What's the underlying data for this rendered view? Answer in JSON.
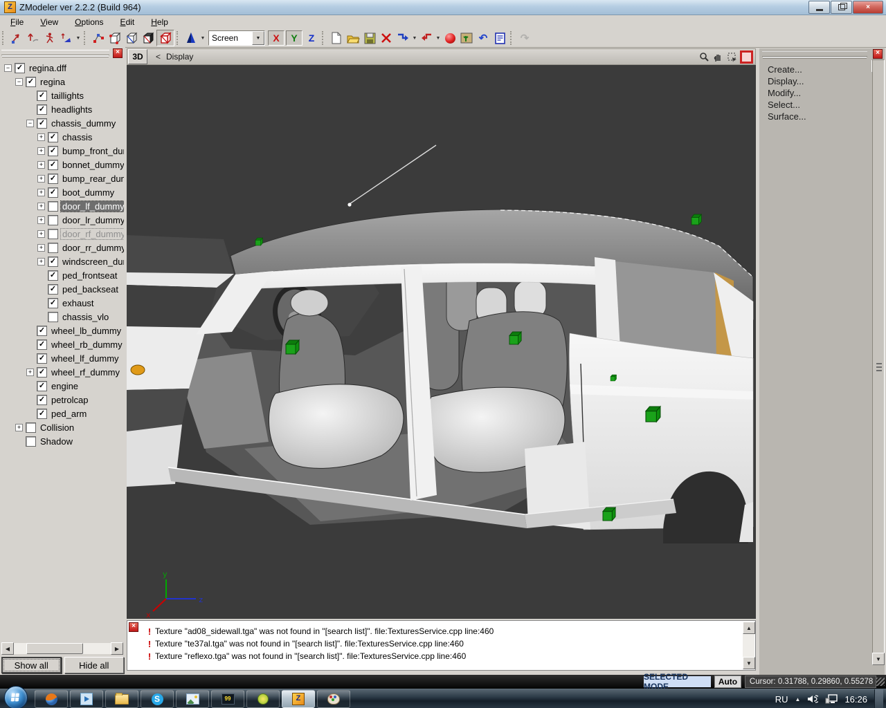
{
  "window": {
    "title": "ZModeler ver 2.2.2 (Build 964)",
    "controls": {
      "minimize": "minimize",
      "restore": "restore",
      "close": "×"
    }
  },
  "menu": {
    "items": [
      "File",
      "View",
      "Options",
      "Edit",
      "Help"
    ]
  },
  "toolbar": {
    "screen_combo": "Screen",
    "axis_x": "X",
    "axis_y": "Y",
    "axis_z": "Z",
    "undo_glyph": "↶",
    "redo_glyph": "↷",
    "icons": [
      "manipulator-move",
      "manipulator-rotate",
      "animate-figure",
      "bone-tool",
      "vertices-level",
      "edges-level",
      "polygons-level",
      "mesh-browser",
      "objects-level",
      "cone-primitive",
      "new-file",
      "open-file",
      "save-file",
      "delete",
      "import",
      "export",
      "material-editor",
      "texture-browser",
      "undo",
      "log-view",
      "redo"
    ]
  },
  "viewport": {
    "mode_button": "3D",
    "back": "<",
    "title": "Display",
    "background": "#3b3b3b"
  },
  "scene_tree": {
    "items": [
      {
        "label": "regina.dff",
        "level": 0,
        "checked": true,
        "expander": "minus",
        "state": "normal"
      },
      {
        "label": "regina",
        "level": 1,
        "checked": true,
        "expander": "minus",
        "state": "normal"
      },
      {
        "label": "taillights",
        "level": 2,
        "checked": true,
        "expander": "none",
        "state": "normal"
      },
      {
        "label": "headlights",
        "level": 2,
        "checked": true,
        "expander": "none",
        "state": "normal"
      },
      {
        "label": "chassis_dummy",
        "level": 2,
        "checked": true,
        "expander": "minus",
        "state": "normal"
      },
      {
        "label": "chassis",
        "level": 3,
        "checked": true,
        "expander": "plus",
        "state": "normal"
      },
      {
        "label": "bump_front_dur",
        "level": 3,
        "checked": true,
        "expander": "plus",
        "state": "normal"
      },
      {
        "label": "bonnet_dummy",
        "level": 3,
        "checked": true,
        "expander": "plus",
        "state": "normal"
      },
      {
        "label": "bump_rear_dum",
        "level": 3,
        "checked": true,
        "expander": "plus",
        "state": "normal"
      },
      {
        "label": "boot_dummy",
        "level": 3,
        "checked": true,
        "expander": "plus",
        "state": "normal"
      },
      {
        "label": "door_lf_dummy",
        "level": 3,
        "checked": false,
        "expander": "plus",
        "state": "selected"
      },
      {
        "label": "door_lr_dummy",
        "level": 3,
        "checked": false,
        "expander": "plus",
        "state": "normal"
      },
      {
        "label": "door_rf_dummy",
        "level": 3,
        "checked": false,
        "expander": "plus",
        "state": "dim"
      },
      {
        "label": "door_rr_dummy",
        "level": 3,
        "checked": false,
        "expander": "plus",
        "state": "normal"
      },
      {
        "label": "windscreen_dum",
        "level": 3,
        "checked": true,
        "expander": "plus",
        "state": "normal"
      },
      {
        "label": "ped_frontseat",
        "level": 3,
        "checked": true,
        "expander": "none",
        "state": "normal"
      },
      {
        "label": "ped_backseat",
        "level": 3,
        "checked": true,
        "expander": "none",
        "state": "normal"
      },
      {
        "label": "exhaust",
        "level": 3,
        "checked": true,
        "expander": "none",
        "state": "normal"
      },
      {
        "label": "chassis_vlo",
        "level": 3,
        "checked": false,
        "expander": "none",
        "state": "normal"
      },
      {
        "label": "wheel_lb_dummy",
        "level": 2,
        "checked": true,
        "expander": "none",
        "state": "normal"
      },
      {
        "label": "wheel_rb_dummy",
        "level": 2,
        "checked": true,
        "expander": "none",
        "state": "normal"
      },
      {
        "label": "wheel_lf_dummy",
        "level": 2,
        "checked": true,
        "expander": "none",
        "state": "normal"
      },
      {
        "label": "wheel_rf_dummy",
        "level": 2,
        "checked": true,
        "expander": "plus",
        "state": "normal"
      },
      {
        "label": "engine",
        "level": 2,
        "checked": true,
        "expander": "none",
        "state": "normal"
      },
      {
        "label": "petrolcap",
        "level": 2,
        "checked": true,
        "expander": "none",
        "state": "normal"
      },
      {
        "label": "ped_arm",
        "level": 2,
        "checked": true,
        "expander": "none",
        "state": "normal"
      },
      {
        "label": "Collision",
        "level": 1,
        "checked": false,
        "expander": "plus",
        "state": "normal"
      },
      {
        "label": "Shadow",
        "level": 1,
        "checked": false,
        "expander": "none",
        "state": "normal"
      }
    ]
  },
  "left_buttons": {
    "show_all": "Show all",
    "hide_all": "Hide all"
  },
  "right_menu": {
    "items": [
      "Create...",
      "Display...",
      "Modify...",
      "Select...",
      "Surface..."
    ]
  },
  "log": {
    "messages": [
      "Texture \"ad08_sidewall.tga\" was not found in \"[search list]\". file:TexturesService.cpp line:460",
      "Texture \"te37al.tga\" was not found in \"[search list]\". file:TexturesService.cpp line:460",
      "Texture \"reflexo.tga\" was not found in \"[search list]\". file:TexturesService.cpp line:460"
    ]
  },
  "status": {
    "mode": "SELECTED MODE",
    "auto": "Auto",
    "cursor": "Cursor: 0.31788, 0.29860, 0.55278"
  },
  "taskbar": {
    "language": "RU",
    "time": "16:26",
    "tv_badge": "99",
    "apps": [
      "firefox",
      "media-player",
      "explorer",
      "skype",
      "image-viewer",
      "tv-player",
      "qip",
      "zmodeler",
      "paint"
    ]
  },
  "colors": {
    "dummy_green": "#1aa21a",
    "marker_orange": "#e09a18",
    "viewport_bg": "#3b3b3b",
    "selection_gray": "#6e6e6e",
    "titlebar_blue": "#b5cde2"
  }
}
